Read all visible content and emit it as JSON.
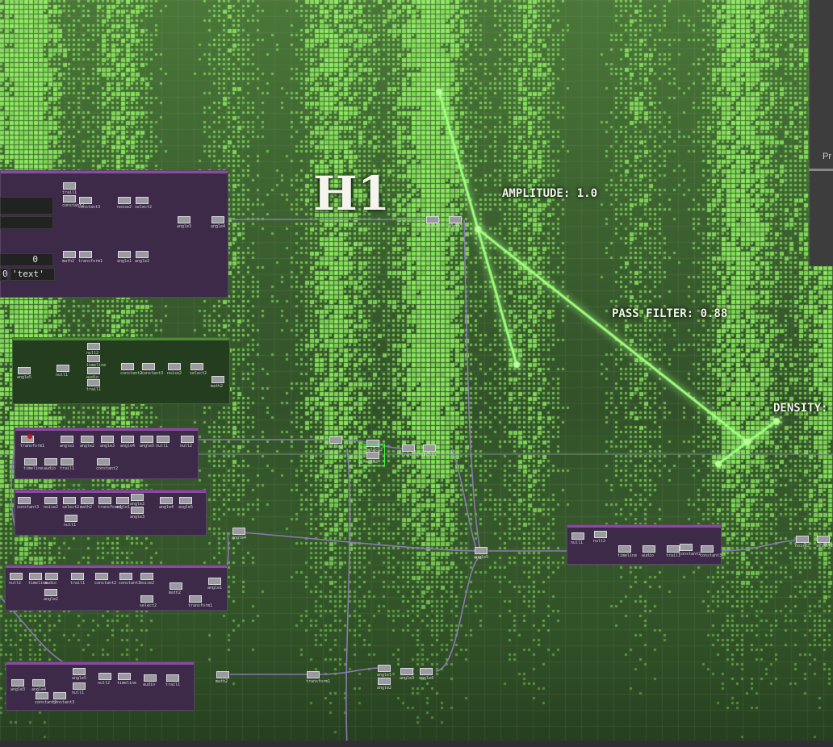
{
  "overlay": {
    "title": "H1",
    "amplitude": "AMPLITUDE: 1.0",
    "pass_filter": "PASS FILTER: 0.88",
    "density": "DENSITY:"
  },
  "side_panel": {
    "text": "Pr"
  },
  "table": {
    "value_zero": "0",
    "value_text": "'text'",
    "index": "0"
  },
  "colors": {
    "accent": "#8fff6a",
    "panel": "#3c2a48",
    "wire": "#8a7ab0",
    "selection": "#3aff3a"
  },
  "nodes": {
    "n1": "trail1",
    "n2": "constant2",
    "n3": "constant3",
    "n4": "noise2",
    "n5": "select2",
    "n6": "math2",
    "n7": "transform1",
    "n8": "angle1",
    "n9": "angle2",
    "n10": "angle3",
    "n11": "angle4",
    "n12": "angle5",
    "n13": "null1",
    "n14": "null2",
    "n15": "timeline",
    "n16": "audio"
  }
}
